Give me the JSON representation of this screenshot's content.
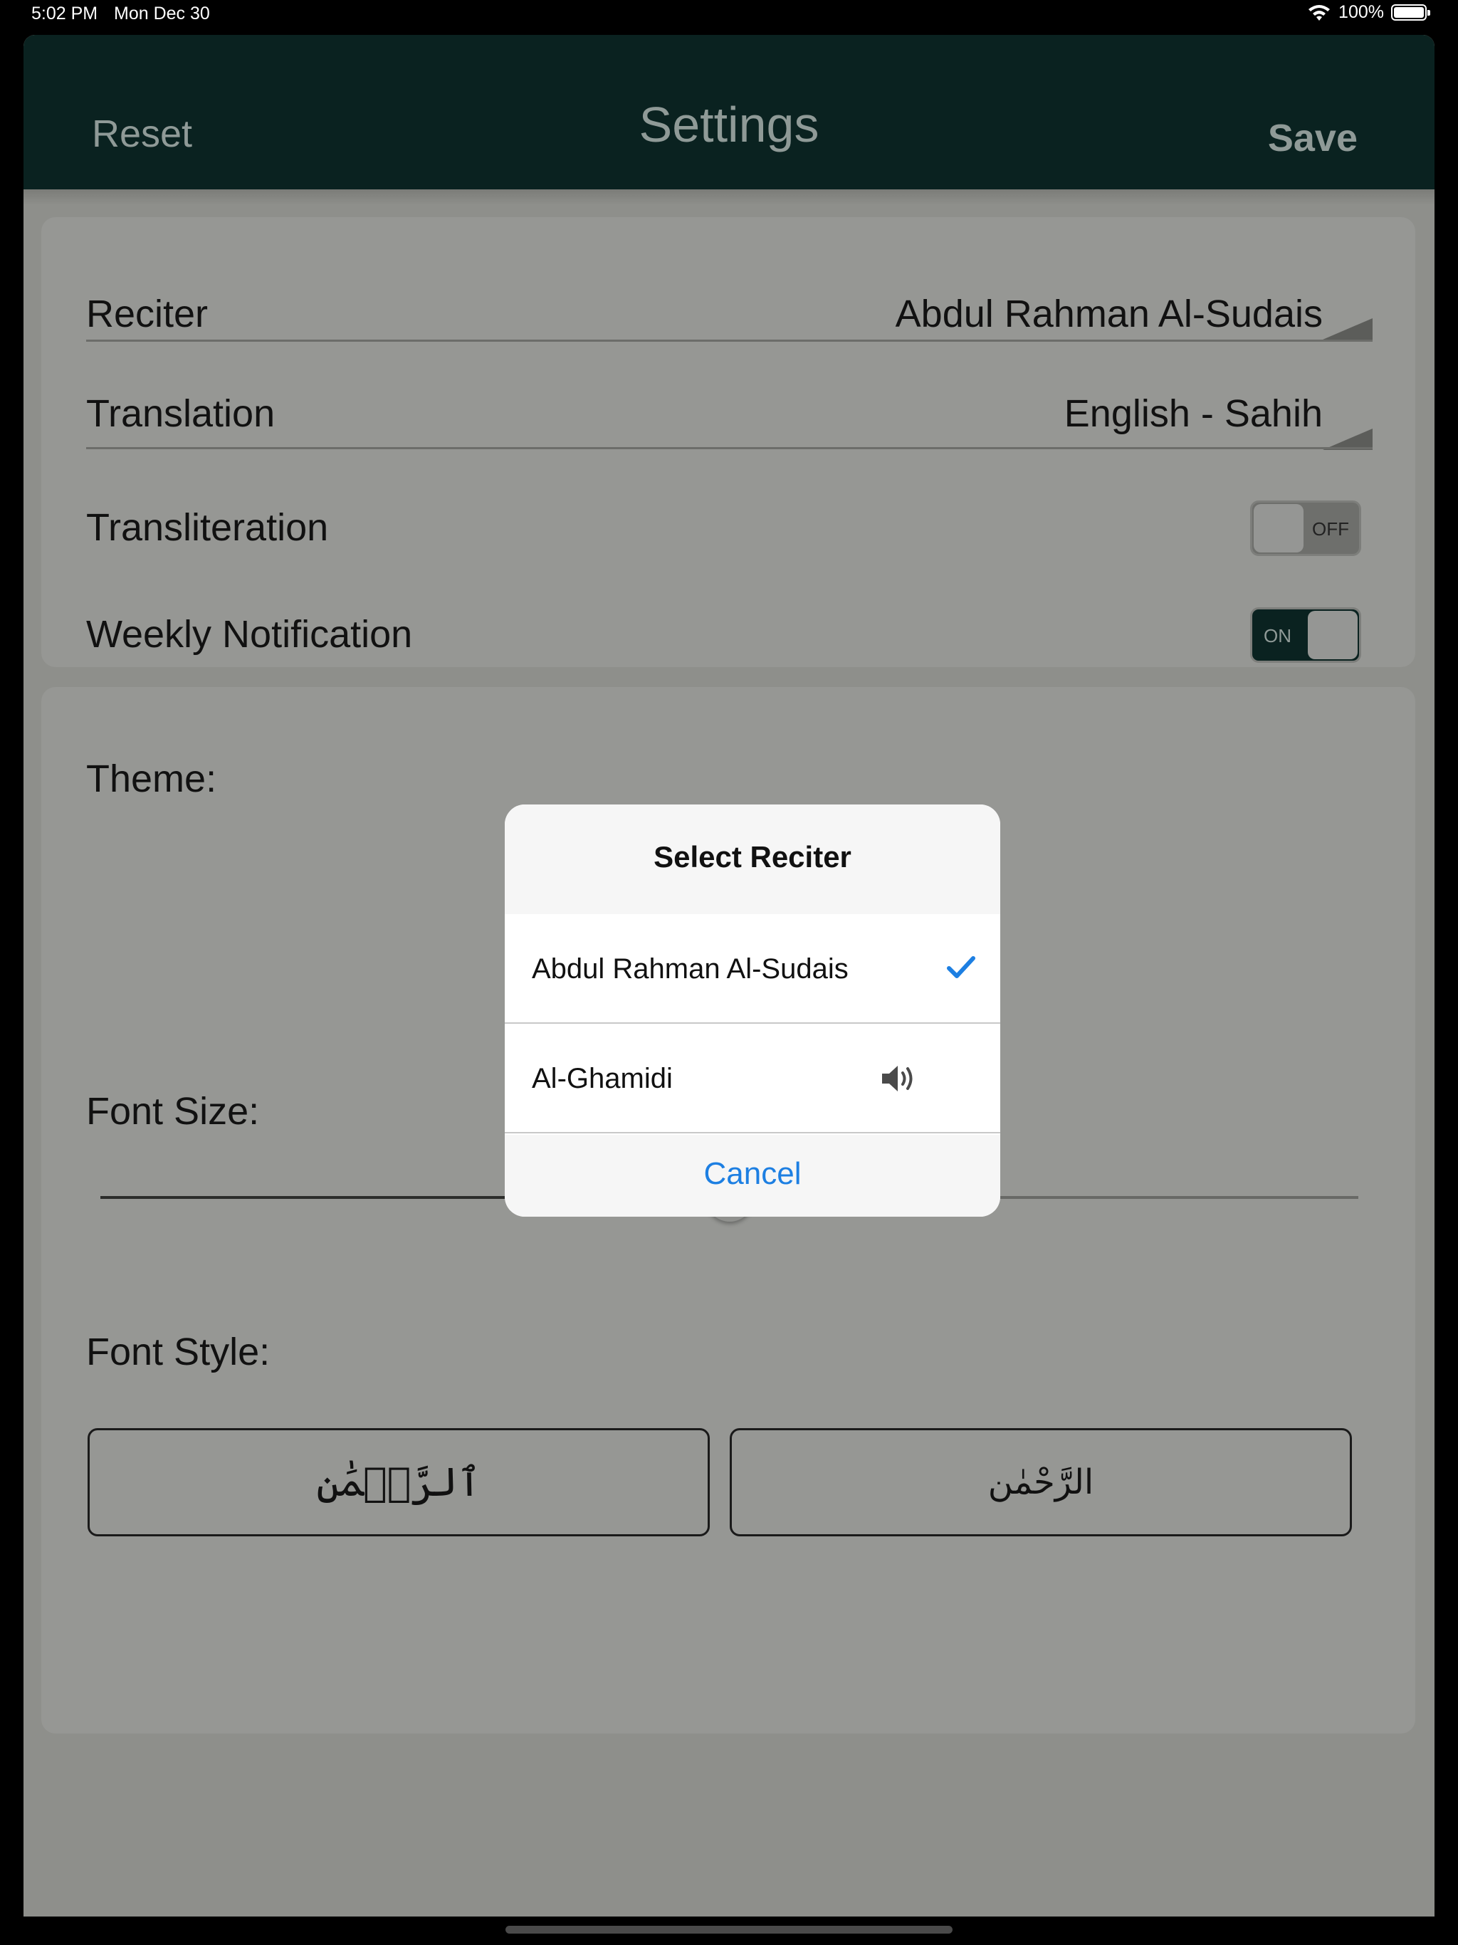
{
  "status_bar": {
    "time": "5:02 PM",
    "date": "Mon Dec 30",
    "battery": "100%",
    "icons": [
      "wifi-icon",
      "battery-icon"
    ]
  },
  "nav": {
    "reset_label": "Reset",
    "title": "Settings",
    "save_label": "Save"
  },
  "settings": {
    "reciter_label": "Reciter",
    "reciter_value": "Abdul Rahman Al-Sudais",
    "translation_label": "Translation",
    "translation_value": "English - Sahih",
    "transliteration_label": "Transliteration",
    "transliteration_toggle": "OFF",
    "weekly_label": "Weekly Notification",
    "weekly_toggle": "ON"
  },
  "appearance": {
    "theme_label": "Theme:",
    "font_size_label": "Font Size:",
    "font_size_fraction": 0.5,
    "font_style_label": "Font Style:",
    "font_style_options": [
      "ٱلرَّحۡمَٰن",
      "الرَّحْمٰن"
    ]
  },
  "dialog": {
    "title": "Select Reciter",
    "options": [
      {
        "label": "Abdul Rahman Al-Sudais",
        "selected": true,
        "icon": "checkmark-icon"
      },
      {
        "label": "Al-Ghamidi",
        "selected": false,
        "icon": "speaker-icon"
      }
    ],
    "cancel_label": "Cancel"
  },
  "colors": {
    "accent_blue": "#1d7fe2",
    "nav_dark": "#0a2220",
    "dim_background": "#8e8f8b"
  }
}
